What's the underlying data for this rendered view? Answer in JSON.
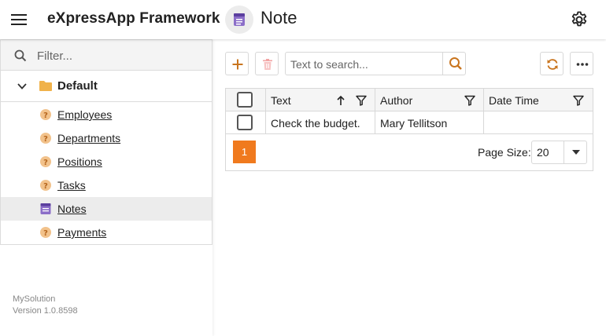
{
  "header": {
    "app_title": "eXpressApp Framework",
    "view_title": "Note",
    "menu_icon": "hamburger-menu-icon",
    "settings_icon": "gear-icon"
  },
  "sidebar": {
    "filter_placeholder": "Filter...",
    "group": {
      "label": "Default",
      "expanded": true
    },
    "items": [
      {
        "label": "Employees",
        "icon": "business-object-icon",
        "active": false
      },
      {
        "label": "Departments",
        "icon": "business-object-icon",
        "active": false
      },
      {
        "label": "Positions",
        "icon": "business-object-icon",
        "active": false
      },
      {
        "label": "Tasks",
        "icon": "business-object-icon",
        "active": false
      },
      {
        "label": "Notes",
        "icon": "note-icon",
        "active": true
      },
      {
        "label": "Payments",
        "icon": "business-object-icon",
        "active": false
      }
    ],
    "footer": {
      "app_name": "MySolution",
      "version": "Version 1.0.8598"
    }
  },
  "toolbar": {
    "search_placeholder": "Text to search..."
  },
  "grid": {
    "columns": [
      {
        "label": "Text",
        "sort": "ascending"
      },
      {
        "label": "Author"
      },
      {
        "label": "Date Time"
      }
    ],
    "rows": [
      {
        "text": "Check the budget.",
        "author": "Mary Tellitson",
        "date_time": ""
      }
    ],
    "pager": {
      "current_page": "1",
      "page_size_label": "Page Size:",
      "page_size_value": "20"
    }
  },
  "colors": {
    "accent": "#f07a1e",
    "search_accent": "#c9751f",
    "folder": "#f0b24a"
  }
}
